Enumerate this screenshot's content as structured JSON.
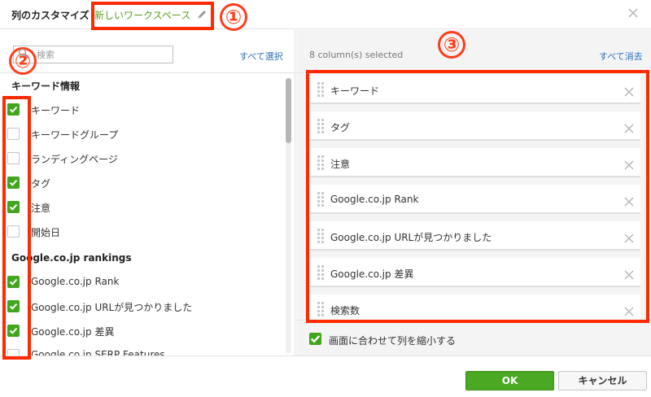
{
  "header": {
    "title": "列のカスタマイズ",
    "workspace": "新しいワークスペース"
  },
  "left": {
    "search_placeholder": "検索",
    "select_all": "すべて選択",
    "groups": [
      {
        "title": "キーワード情報"
      },
      {
        "title": "Google.co.jp rankings"
      }
    ],
    "items": [
      {
        "label": "キーワード",
        "checked": true
      },
      {
        "label": "キーワードグループ",
        "checked": false
      },
      {
        "label": "ランディングページ",
        "checked": false
      },
      {
        "label": "タグ",
        "checked": true
      },
      {
        "label": "注意",
        "checked": true
      },
      {
        "label": "開始日",
        "checked": false
      },
      {
        "label": "Google.co.jp Rank",
        "checked": true
      },
      {
        "label": "Google.co.jp URLが見つかりました",
        "checked": true
      },
      {
        "label": "Google.co.jp 差異",
        "checked": true
      },
      {
        "label": "Google.co.jp SERP Features",
        "checked": false
      }
    ]
  },
  "right": {
    "count": "8 column(s) selected",
    "clear_all": "すべて消去",
    "selected": [
      {
        "label": "キーワード"
      },
      {
        "label": "タグ"
      },
      {
        "label": "注意"
      },
      {
        "label": "Google.co.jp Rank"
      },
      {
        "label": "Google.co.jp URLが見つかりました"
      },
      {
        "label": "Google.co.jp 差異"
      },
      {
        "label": "検索数"
      }
    ],
    "fit_label": "画面に合わせて列を縮小する",
    "fit_checked": true
  },
  "footer": {
    "ok": "OK",
    "cancel": "キャンセル"
  },
  "annotations": [
    {
      "label": "①"
    },
    {
      "label": "②"
    },
    {
      "label": "③"
    }
  ],
  "colors": {
    "accent_green": "#43a51e",
    "link_blue": "#2d6fb6",
    "annotation_red": "#ff2a00"
  }
}
